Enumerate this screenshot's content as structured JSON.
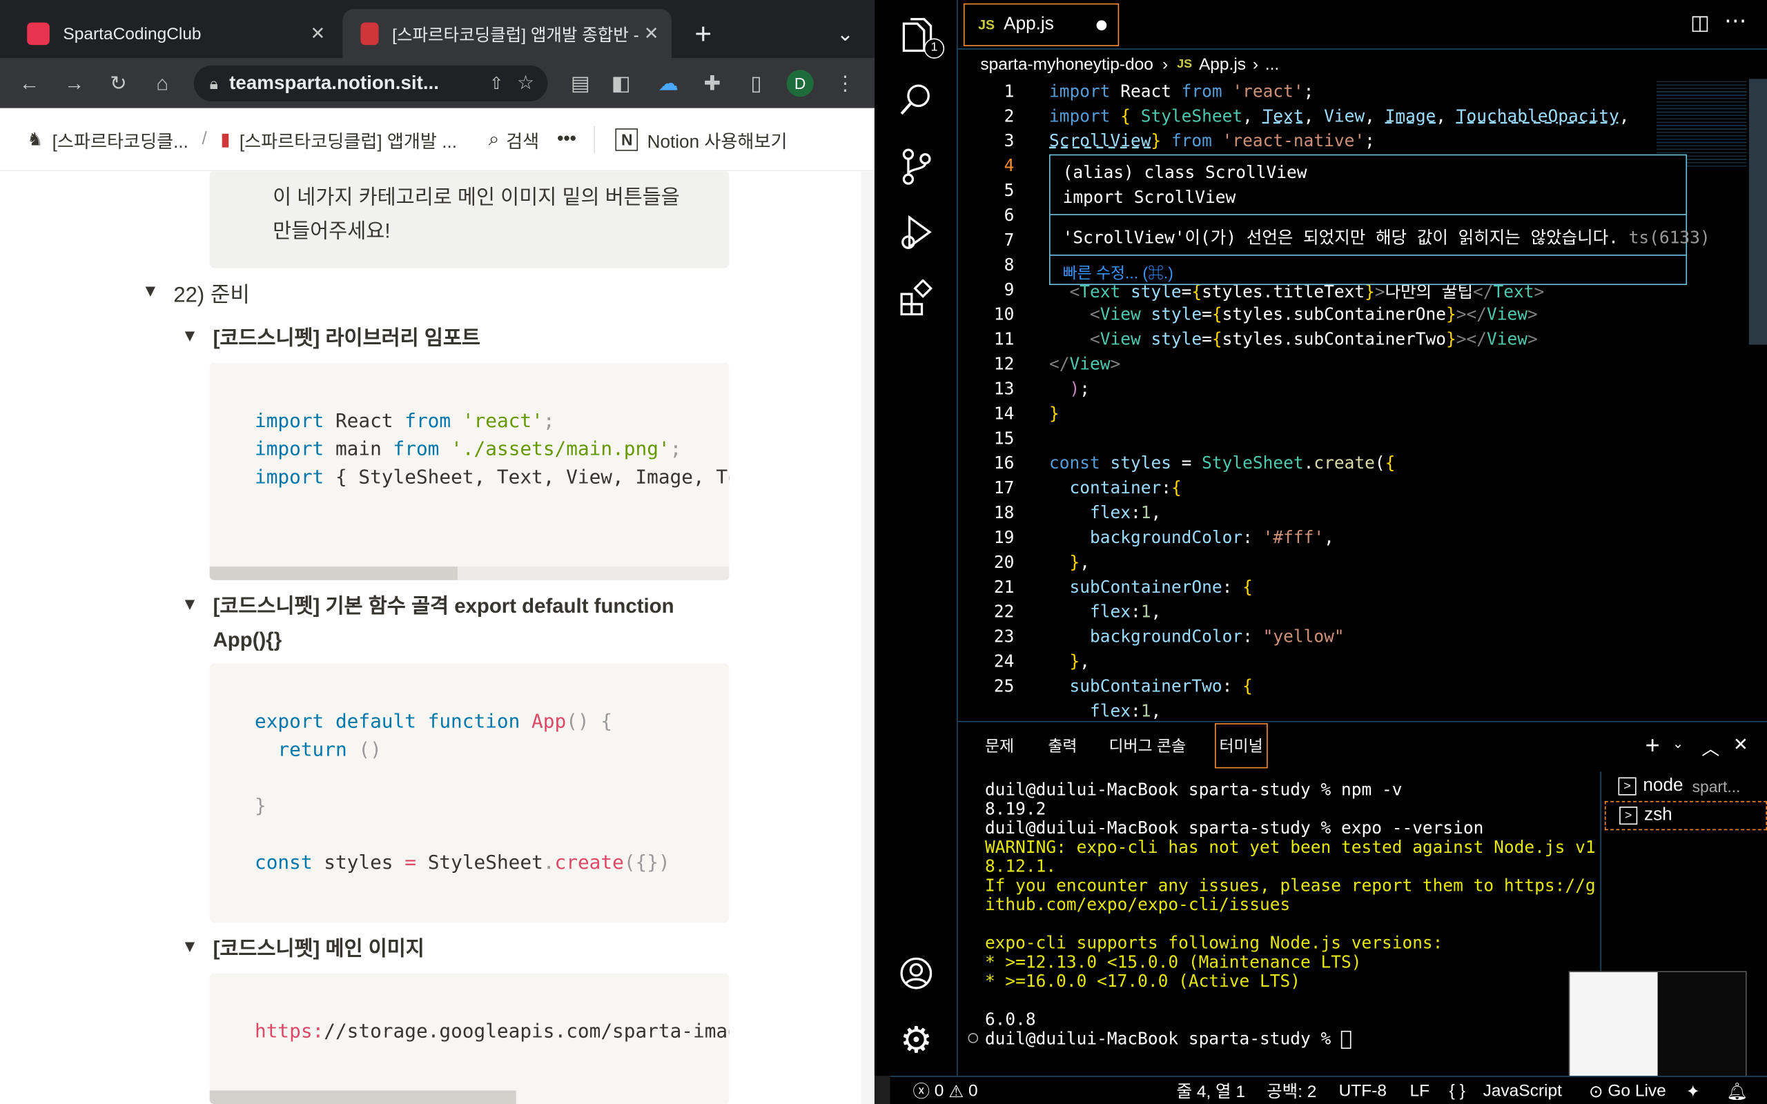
{
  "browser": {
    "tabs": [
      {
        "title": "SpartaCodingClub",
        "active": false
      },
      {
        "title": "[스파르타코딩클럽] 앱개발 종합반 -",
        "active": true
      }
    ],
    "url": "teamsparta.notion.sit...",
    "profile_initial": "D",
    "bookmarks": {
      "crumb1": "[스파르타코딩클...",
      "separator": "/",
      "crumb2": "[스파르타코딩클럽] 앱개발 ...",
      "search_label": "검색",
      "more": "•••",
      "notion_label": "Notion 사용해보기"
    }
  },
  "notion": {
    "callout_line1": "이 네가지 카테고리로 메인 이미지 밑의 버튼들을",
    "callout_line2": "만들어주세요!",
    "section_title": "22) 준비",
    "toggle1": "[코드스니펫] 라이브러리 임포트",
    "code1": [
      [
        "kw",
        "import"
      ],
      [
        "",
        " React "
      ],
      [
        "kw",
        "from"
      ],
      [
        "",
        " "
      ],
      [
        "str",
        "'react'"
      ],
      [
        "pu",
        ";"
      ]
    ],
    "code1_line2_a": "import",
    "code1_line2_b": " main ",
    "code1_line2_c": "from",
    "code1_line2_d": "'./assets/main.png'",
    "code1_line2_e": ";",
    "code1_line3_a": "import",
    "code1_line3_b": " { StyleSheet, Text, View, Image, To",
    "toggle2_line1": "[코드스니펫] 기본 함수 골격 export default function",
    "toggle2_line2": "App(){}",
    "code2": {
      "l1_kw": "export default function",
      "l1_fn": " App",
      "l1_rest": "() {",
      "l2_kw": "return",
      "l2_rest": " ()",
      "l4": "}",
      "l6_kw": "const",
      "l6_a": " styles ",
      "l6_op": "=",
      "l6_b": " StyleSheet",
      "l6_dot": ".",
      "l6_fn": "create",
      "l6_end": "({})"
    },
    "toggle3": "[코드스니펫] 메인 이미지",
    "code3_a": "https:",
    "code3_b": "//storage",
    "code3_c": ".googleapis",
    "code3_d": ".com/sparta-imag"
  },
  "vscode": {
    "tab_label": "App.js",
    "tab_lang": "JS",
    "breadcrumb_folder": "sparta-myhoneytip-doo",
    "breadcrumb_file": "App.js",
    "breadcrumb_more": "...",
    "source_control_badge": "1",
    "hover": {
      "line1": "(alias) class ScrollView",
      "line2": "import ScrollView",
      "message": "'ScrollView'이(가) 선언은 되었지만 해당 값이 읽히지는 않았습니다.",
      "code": "ts(6133)",
      "quick_fix": "빠른 수정... (⌘.)"
    },
    "line_numbers": [
      "1",
      "2",
      "3",
      "4",
      "5",
      "6",
      "7",
      "8",
      "9",
      "10",
      "11",
      "12",
      "13",
      "14",
      "15",
      "16",
      "17",
      "18",
      "19",
      "20",
      "21",
      "22",
      "23",
      "24",
      "25"
    ],
    "panel_tabs": [
      "문제",
      "출력",
      "디버그 콘솔",
      "터미널"
    ],
    "terminal_lines": [
      "duil@duilui-MacBook sparta-study % npm -v",
      "8.19.2",
      "duil@duilui-MacBook sparta-study % expo --version",
      "WARNING: expo-cli has not yet been tested against Node.js v1",
      "8.12.1.",
      "If you encounter any issues, please report them to https://g",
      "ithub.com/expo/expo-cli/issues",
      "",
      "expo-cli supports following Node.js versions:",
      "* >=12.13.0 <15.0.0 (Maintenance LTS)",
      "* >=16.0.0 <17.0.0 (Active LTS)",
      "",
      "6.0.8",
      "duil@duilui-MacBook sparta-study % "
    ],
    "terminals": [
      {
        "name": "node",
        "detail": "spart..."
      },
      {
        "name": "zsh",
        "detail": ""
      }
    ],
    "status": {
      "errors": "0",
      "warnings": "0",
      "position": "줄 4, 열 1",
      "spaces": "공백: 2",
      "encoding": "UTF-8",
      "eol": "LF",
      "braces": "{ }",
      "language": "JavaScript",
      "golive": "Go Live"
    }
  },
  "colors": {
    "chrome_dark": "#202124",
    "vscode_border": "#1f4a66",
    "hover_border": "#6fc3df",
    "active_tab_border": "#f28b31"
  }
}
